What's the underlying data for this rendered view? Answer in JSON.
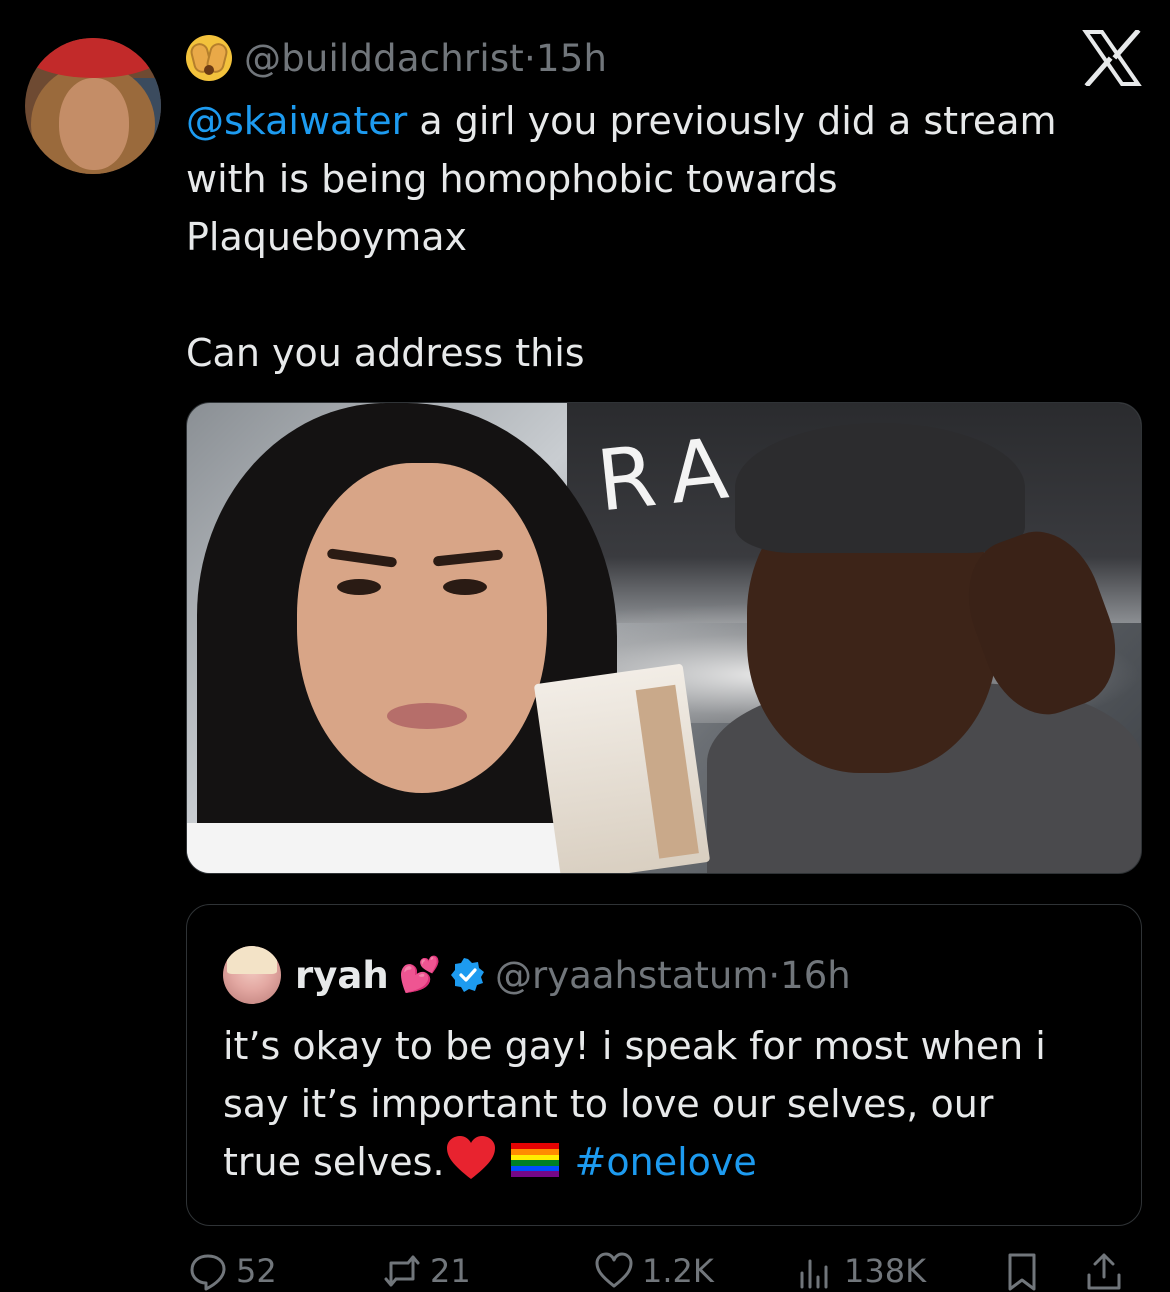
{
  "tweet": {
    "author_handle": "@builddachrist",
    "separator": "·",
    "time": "15h",
    "author_emoji": "face-with-open-eyes-and-hand-over-mouth",
    "mention": "@skaiwater",
    "text_line1_rest": " a girl you previously did a stream",
    "text_line2": "with is being homophobic towards",
    "text_line3": "Plaqueboymax",
    "text_line4": "Can you address this"
  },
  "quoted_tweet": {
    "name": "ryah",
    "name_emoji": "💕",
    "verified": true,
    "handle": "@ryaahstatum",
    "separator": "·",
    "time": "16h",
    "text_line1": "it’s okay to be gay! i speak for most when i",
    "text_line2": "say it’s important to love our selves, our",
    "text_line3": "true selves.",
    "hashtag": "#onelove"
  },
  "media": {
    "sign_text": "RA"
  },
  "actions": {
    "replies": "52",
    "reposts": "21",
    "likes": "1.2K",
    "views": "138K"
  },
  "icons": {
    "close": "x-logo-icon",
    "reply": "reply-icon",
    "repost": "repost-icon",
    "like": "heart-icon",
    "views": "analytics-icon",
    "bookmark": "bookmark-icon",
    "share": "share-icon"
  },
  "colors": {
    "background": "#000000",
    "text": "#e7e9ea",
    "secondary": "#71767b",
    "accent": "#1d9bf0",
    "border": "#2f3336"
  }
}
